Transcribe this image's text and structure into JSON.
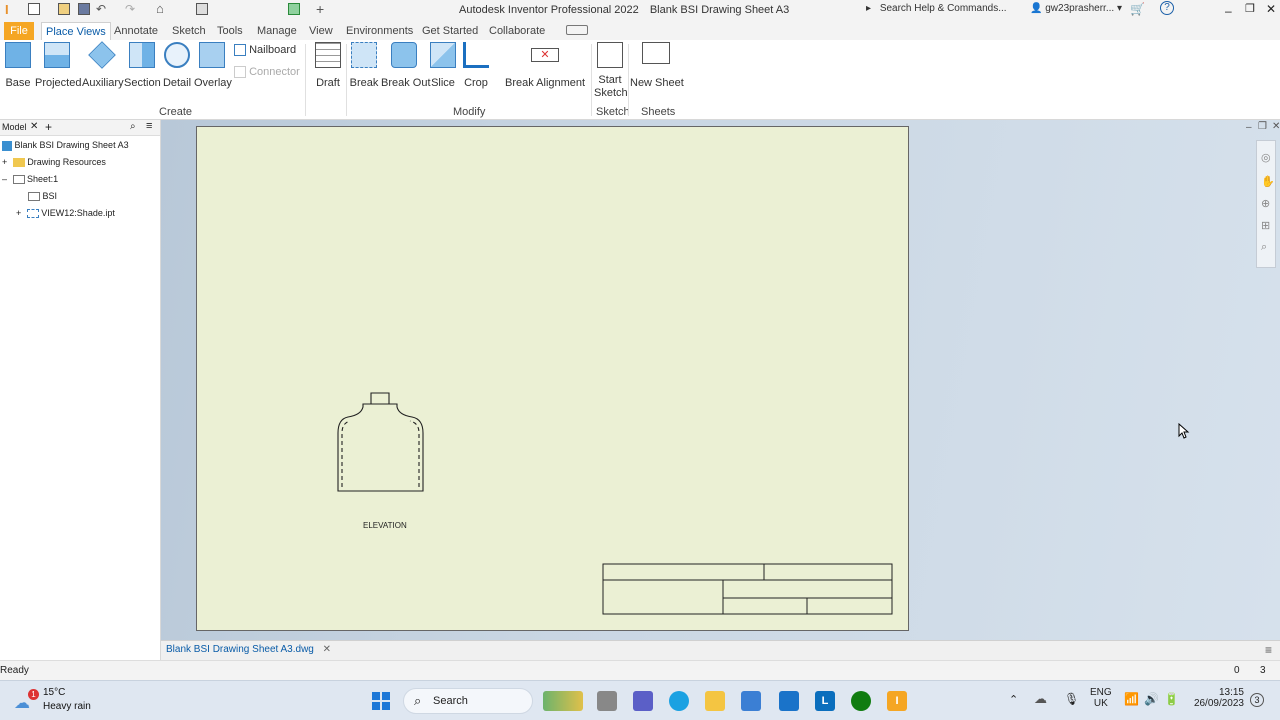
{
  "titlebar": {
    "app_title": "Autodesk Inventor Professional 2022",
    "doc_title": "Blank BSI Drawing Sheet A3",
    "search_placeholder": "Search Help & Commands...",
    "user": "gw23prasherr..."
  },
  "tabs": [
    "File",
    "Place Views",
    "Annotate",
    "Sketch",
    "Tools",
    "Manage",
    "View",
    "Environments",
    "Get Started",
    "Collaborate"
  ],
  "ribbon": {
    "create": {
      "label": "Create",
      "buttons": [
        "Base",
        "Projected",
        "Auxiliary",
        "Section",
        "Detail",
        "Overlay"
      ],
      "nailboard": "Nailboard",
      "connector": "Connector"
    },
    "modify": {
      "label": "Modify",
      "buttons": [
        "Draft",
        "Break",
        "Break Out",
        "Slice",
        "Crop"
      ],
      "break_alignment": "Break Alignment"
    },
    "sketch": {
      "label": "Sketch",
      "button_line1": "Start",
      "button_line2": "Sketch"
    },
    "sheets": {
      "label": "Sheets",
      "button": "New Sheet"
    }
  },
  "browser": {
    "tab": "Model",
    "items": [
      {
        "label": "Blank BSI Drawing Sheet A3"
      },
      {
        "label": "Drawing Resources"
      },
      {
        "label": "Sheet:1"
      },
      {
        "label": "BSI"
      },
      {
        "label": "VIEW12:Shade.ipt"
      }
    ]
  },
  "drawing": {
    "view_label": "ELEVATION"
  },
  "doc_tab": "Blank BSI Drawing Sheet A3.dwg",
  "status": {
    "text": "Ready",
    "count1": "0",
    "count2": "3"
  },
  "taskbar": {
    "weather_temp": "15°C",
    "weather_desc": "Heavy rain",
    "weather_badge": "1",
    "search": "Search",
    "lang1": "ENG",
    "lang2": "UK",
    "time": "13:15",
    "date": "26/09/2023",
    "notif": "3"
  },
  "colors": {
    "accent": "#0a5ca8",
    "file_tab": "#f5a623",
    "sheet": "#ebf0d4"
  }
}
